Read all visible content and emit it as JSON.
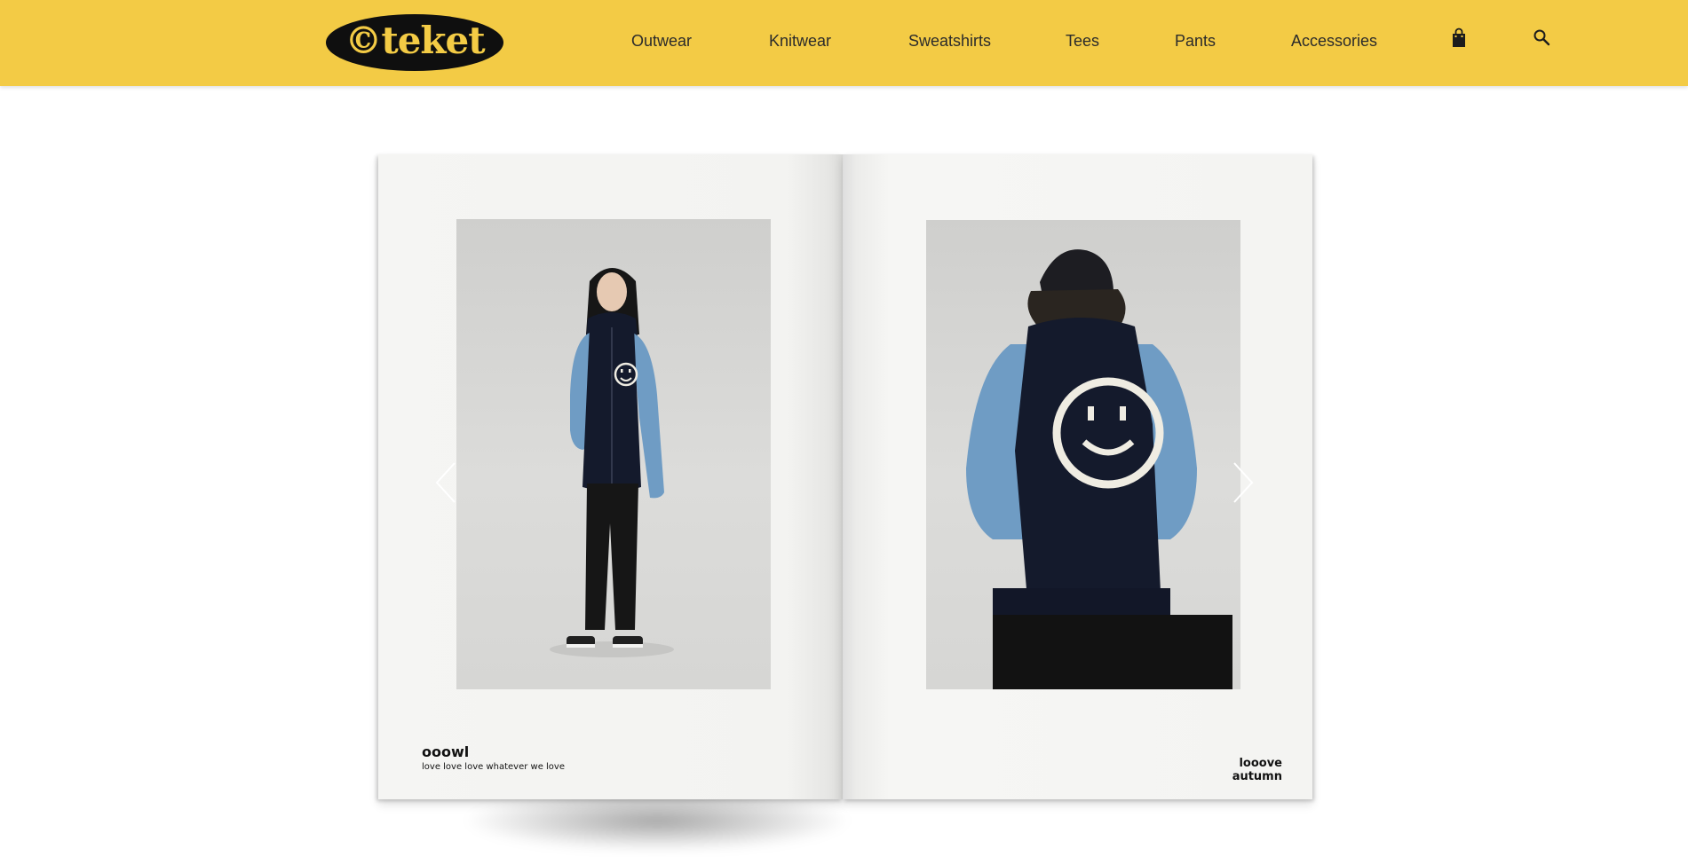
{
  "brand": {
    "logo_text": "©teket"
  },
  "nav": {
    "items": [
      {
        "label": "Outwear"
      },
      {
        "label": "Knitwear"
      },
      {
        "label": "Sweatshirts"
      },
      {
        "label": "Tees"
      },
      {
        "label": "Pants"
      },
      {
        "label": "Accessories"
      }
    ],
    "icons": [
      "shopping-bag-icon",
      "search-icon"
    ]
  },
  "lookbook": {
    "left_page": {
      "title": "ooowl",
      "subtitle": "love love love whatever we love"
    },
    "right_page": {
      "caption": "looove autumn"
    },
    "controls": [
      "previous-arrow-icon",
      "next-arrow-icon"
    ]
  },
  "colors": {
    "header_bg": "#f3cb45",
    "logo_bg": "#0f0f0f",
    "page_bg": "#f4f4f2",
    "navy": "#151a2c",
    "sky_blue": "#6f9cc4"
  }
}
